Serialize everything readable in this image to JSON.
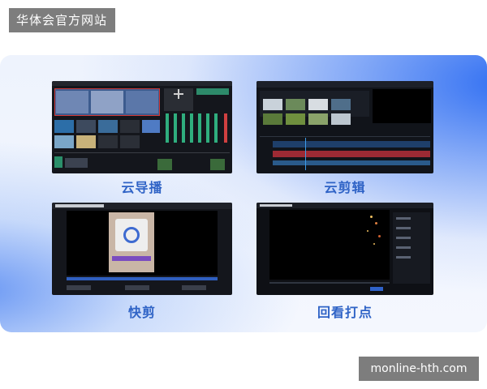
{
  "site_label": "华体会官方网站",
  "url_label": "monline-hth.com",
  "tiles": [
    {
      "caption": "云导播"
    },
    {
      "caption": "云剪辑"
    },
    {
      "caption": "快剪"
    },
    {
      "caption": "回看打点"
    }
  ]
}
